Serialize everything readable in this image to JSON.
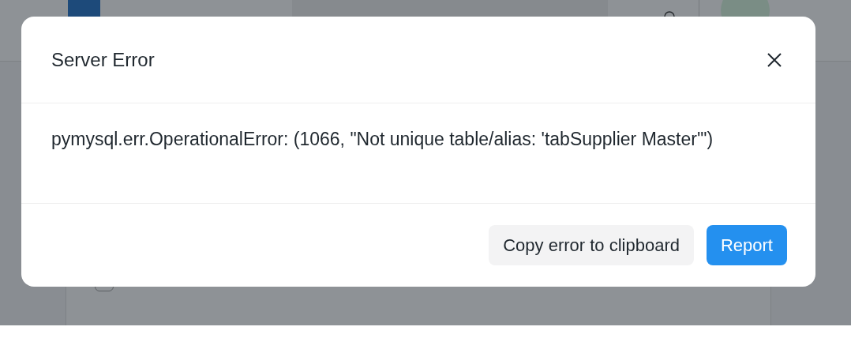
{
  "list": {
    "checked": false
  },
  "dialog": {
    "title": "Server Error",
    "message": "pymysql.err.OperationalError: (1066, \"Not unique table/alias: 'tabSupplier Master'\")",
    "buttons": [
      {
        "label": "Copy error to clipboard",
        "kind": "secondary"
      },
      {
        "label": "Report",
        "kind": "primary"
      }
    ]
  }
}
